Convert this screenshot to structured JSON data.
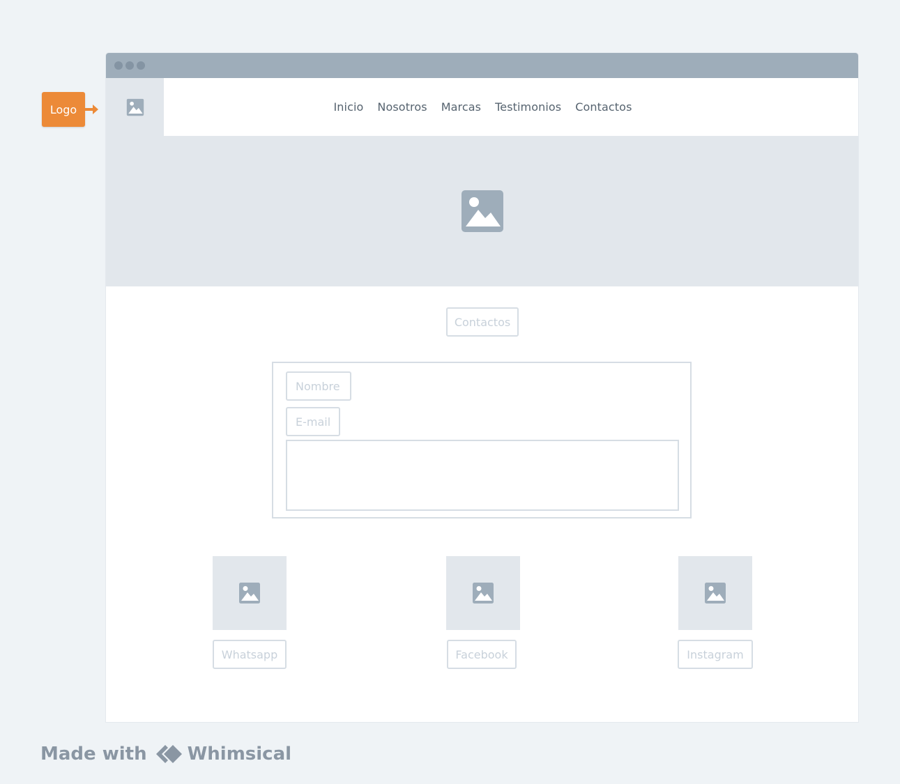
{
  "annotation": {
    "label": "Logo",
    "color": "#ec8a38"
  },
  "nav": {
    "items": [
      "Inicio",
      "Nosotros",
      "Marcas",
      "Testimonios",
      "Contactos"
    ]
  },
  "contact_title": "Contactos",
  "form": {
    "name_placeholder": "Nombre",
    "email_placeholder": "E-mail"
  },
  "social": {
    "items": [
      "Whatsapp",
      "Facebook",
      "Instagram"
    ]
  },
  "footer": {
    "made_with": "Made with",
    "brand": "Whimsical"
  },
  "colors": {
    "background": "#eff3f6",
    "titlebar": "#9eadba",
    "placeholder_fill": "#e2e7ec",
    "icon": "#9eadba",
    "outline": "#d6dde4"
  }
}
